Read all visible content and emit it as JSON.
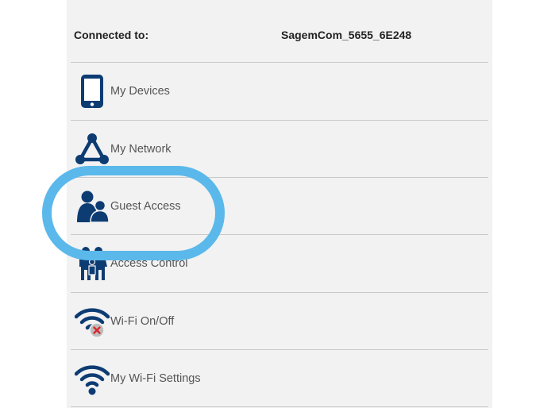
{
  "connection": {
    "label": "Connected to:",
    "network_name": "SagemCom_5655_6E248"
  },
  "menu": {
    "items": [
      {
        "label": "My Devices",
        "icon": "phone-icon"
      },
      {
        "label": "My Network",
        "icon": "network-icon"
      },
      {
        "label": "Guest Access",
        "icon": "guests-icon"
      },
      {
        "label": "Access Control",
        "icon": "family-icon"
      },
      {
        "label": "Wi-Fi On/Off",
        "icon": "wifi-off-icon"
      },
      {
        "label": "My Wi-Fi Settings",
        "icon": "wifi-icon"
      }
    ]
  },
  "colors": {
    "icon_blue": "#0d3c73",
    "highlight": "#5bb8ea",
    "panel_bg": "#f2f2f2",
    "divider": "#c8c8c8"
  }
}
